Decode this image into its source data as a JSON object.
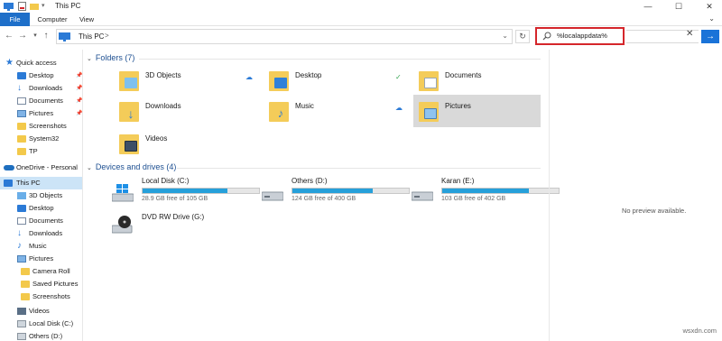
{
  "window": {
    "title": "This PC",
    "minimize": "—",
    "maximize": "☐",
    "close": "✕"
  },
  "ribbon": {
    "tabs": [
      "File",
      "Computer",
      "View"
    ],
    "expand_icon": "chevron-down-icon"
  },
  "address": {
    "path": "This PC",
    "separator": ">",
    "search_value": "%localappdata%",
    "search_clear": "✕",
    "search_go": "→"
  },
  "sidebar": {
    "items": [
      {
        "label": "Quick access",
        "icon": "star-icon",
        "pinned": false
      },
      {
        "label": "Desktop",
        "icon": "desktop-icon",
        "pinned": true
      },
      {
        "label": "Downloads",
        "icon": "downloads-icon",
        "pinned": true
      },
      {
        "label": "Documents",
        "icon": "documents-icon",
        "pinned": true
      },
      {
        "label": "Pictures",
        "icon": "pictures-icon",
        "pinned": true
      },
      {
        "label": "Screenshots",
        "icon": "folder-icon",
        "pinned": false
      },
      {
        "label": "System32",
        "icon": "folder-icon",
        "pinned": false
      },
      {
        "label": "TP",
        "icon": "folder-icon",
        "pinned": false
      },
      {
        "label": "OneDrive - Personal",
        "icon": "onedrive-icon",
        "pinned": false
      },
      {
        "label": "This PC",
        "icon": "pc-icon",
        "pinned": false
      },
      {
        "label": "3D Objects",
        "icon": "3d-objects-icon",
        "pinned": false
      },
      {
        "label": "Desktop",
        "icon": "desktop-icon",
        "pinned": false
      },
      {
        "label": "Documents",
        "icon": "documents-icon",
        "pinned": false
      },
      {
        "label": "Downloads",
        "icon": "downloads-icon",
        "pinned": false
      },
      {
        "label": "Music",
        "icon": "music-icon",
        "pinned": false
      },
      {
        "label": "Pictures",
        "icon": "pictures-icon",
        "pinned": false
      },
      {
        "label": "Camera Roll",
        "icon": "folder-icon",
        "pinned": false
      },
      {
        "label": "Saved Pictures",
        "icon": "folder-icon",
        "pinned": false
      },
      {
        "label": "Screenshots",
        "icon": "folder-icon",
        "pinned": false
      },
      {
        "label": "Videos",
        "icon": "videos-icon",
        "pinned": false
      },
      {
        "label": "Local Disk (C:)",
        "icon": "drive-icon",
        "pinned": false
      },
      {
        "label": "Others (D:)",
        "icon": "drive-icon",
        "pinned": false
      }
    ]
  },
  "folders": {
    "header": "Folders (7)",
    "items": [
      {
        "name": "3D Objects",
        "status": ""
      },
      {
        "name": "Desktop",
        "status": "cloud"
      },
      {
        "name": "Documents",
        "status": "synced"
      },
      {
        "name": "Downloads",
        "status": ""
      },
      {
        "name": "Music",
        "status": ""
      },
      {
        "name": "Pictures",
        "status": "cloud"
      },
      {
        "name": "Videos",
        "status": ""
      }
    ]
  },
  "drives": {
    "header": "Devices and drives (4)",
    "items": [
      {
        "name": "Local Disk (C:)",
        "free": "28.9 GB free of 105 GB",
        "used_fraction": 0.725
      },
      {
        "name": "Others (D:)",
        "free": "124 GB free of 400 GB",
        "used_fraction": 0.69
      },
      {
        "name": "Karan (E:)",
        "free": "103 GB free of 402 GB",
        "used_fraction": 0.744
      },
      {
        "name": "DVD RW Drive (G:)",
        "free": "",
        "used_fraction": null
      }
    ]
  },
  "preview": {
    "text": "No preview available."
  },
  "watermark": "wsxdn.com",
  "colors": {
    "accent": "#1e6fc9",
    "search_highlight": "#d5262b",
    "drive_bar": "#26a0da",
    "selection": "#cce4f7"
  }
}
